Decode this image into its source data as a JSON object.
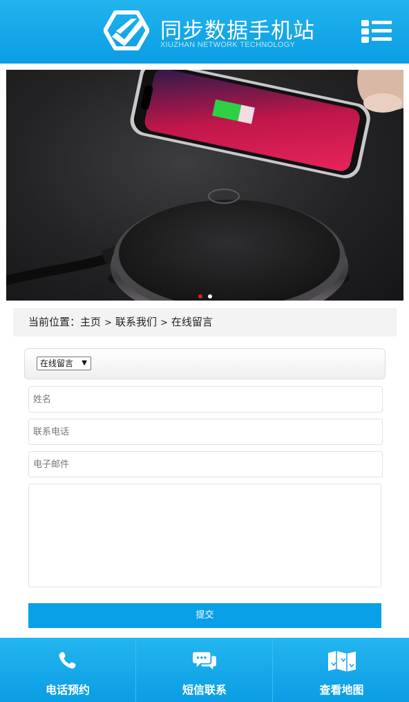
{
  "header": {
    "title": "同步数据手机站",
    "subtitle": "XIUZHAN NETWORK TECHNOLOGY",
    "logo_icon": "hexagon-checkmark-logo",
    "menu_icon": "list-menu-icon"
  },
  "banner": {
    "image": "phone-on-wireless-charger",
    "slide_count": 2,
    "active_slide": 1
  },
  "breadcrumb": {
    "prefix": "当前位置：",
    "items": [
      "主页",
      "联系我们",
      "在线留言"
    ],
    "separator": ">"
  },
  "form": {
    "category_select": {
      "selected": "在线留言"
    },
    "name_placeholder": "姓名",
    "phone_placeholder": "联系电话",
    "email_placeholder": "电子邮件",
    "message_placeholder": "",
    "submit_label": "提交"
  },
  "footer_nav": {
    "items": [
      {
        "label": "电话预约",
        "icon": "phone-icon"
      },
      {
        "label": "短信联系",
        "icon": "chat-bubbles-icon"
      },
      {
        "label": "查看地图",
        "icon": "map-icon"
      }
    ]
  },
  "colors": {
    "brand": "#0aa0e8",
    "header_top": "#22b4ee",
    "dot_active": "#e02020"
  }
}
